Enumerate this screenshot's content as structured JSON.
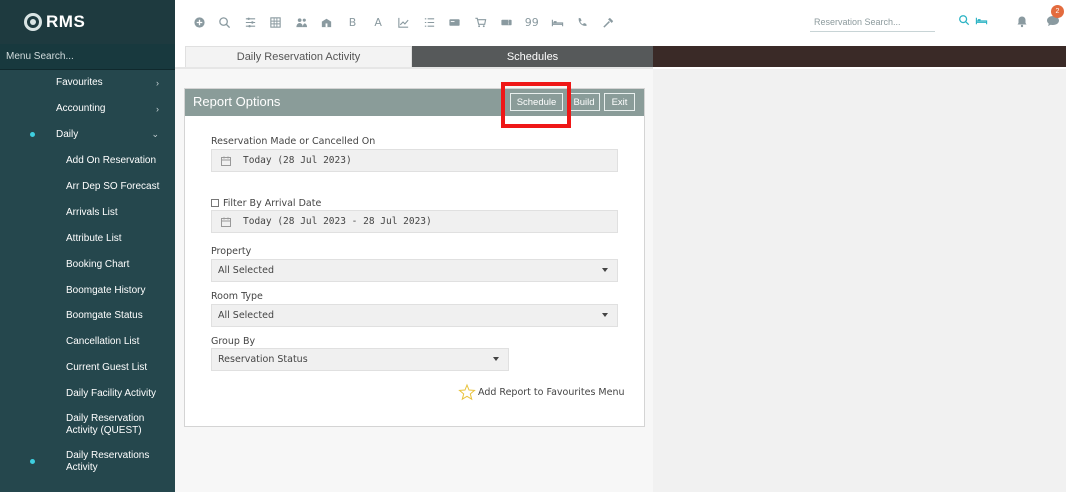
{
  "app": {
    "logo_text": "RMS",
    "brand_color": "#1e3a3f",
    "accent_color": "#2bb3c4"
  },
  "toolbar": {
    "icons": [
      "add-circle-icon",
      "search-icon",
      "sliders-icon",
      "grid-icon",
      "group-icon",
      "building-icon",
      "bold-b-icon",
      "font-a-icon",
      "line-chart-icon",
      "list-icon",
      "card-icon",
      "cart-icon",
      "ticket-icon",
      "quote-icon",
      "bed-icon",
      "phone-icon",
      "hammer-icon"
    ],
    "letter_b": "B",
    "letter_a": "A",
    "quote": "99"
  },
  "header": {
    "search_placeholder": "Reservation Search...",
    "notification_count": "2"
  },
  "sidebar": {
    "search_label": "Menu Search...",
    "items": [
      {
        "label": "Favourites",
        "has_chevron": true,
        "chevron": "›"
      },
      {
        "label": "Accounting",
        "has_chevron": true,
        "chevron": "›"
      },
      {
        "label": "Daily",
        "has_chevron": true,
        "chevron": "⌄",
        "active": true
      },
      {
        "label": "Add On Reservation"
      },
      {
        "label": "Arr Dep SO Forecast"
      },
      {
        "label": "Arrivals List"
      },
      {
        "label": "Attribute List"
      },
      {
        "label": "Booking Chart"
      },
      {
        "label": "Boomgate History"
      },
      {
        "label": "Boomgate Status"
      },
      {
        "label": "Cancellation List"
      },
      {
        "label": "Current Guest List"
      },
      {
        "label": "Daily Facility Activity"
      },
      {
        "label": "Daily Reservation Activity (QUEST)"
      },
      {
        "label": "Daily Reservations Activity",
        "active": true
      }
    ]
  },
  "tabs": [
    {
      "label": "Daily Reservation Activity",
      "active": true
    },
    {
      "label": "Schedules",
      "active": false
    }
  ],
  "report": {
    "title": "Report Options",
    "buttons": {
      "schedule": "Schedule",
      "build": "Build",
      "exit": "Exit"
    },
    "made_or_cancelled_label": "Reservation Made or Cancelled On",
    "made_or_cancelled_value": "Today (28 Jul 2023)",
    "filter_arrival_label": "Filter By Arrival Date",
    "filter_arrival_value": "Today (28 Jul 2023 - 28 Jul 2023)",
    "property_label": "Property",
    "property_value": "All Selected",
    "room_type_label": "Room Type",
    "room_type_value": "All Selected",
    "group_by_label": "Group By",
    "group_by_value": "Reservation Status",
    "favourites_link": "Add Report to Favourites Menu"
  }
}
